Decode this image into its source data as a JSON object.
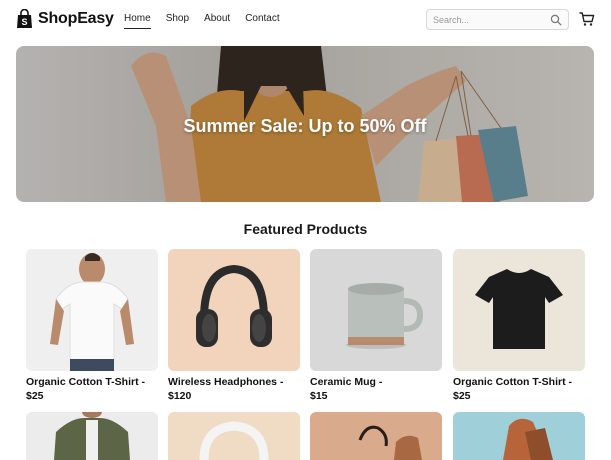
{
  "header": {
    "brand": "ShopEasy",
    "nav": [
      {
        "label": "Home",
        "active": true
      },
      {
        "label": "Shop",
        "active": false
      },
      {
        "label": "About",
        "active": false
      },
      {
        "label": "Contact",
        "active": false
      }
    ],
    "search_placeholder": "Search...",
    "icons": {
      "search": "search-icon",
      "cart": "cart-icon",
      "logo": "shopping-bag-icon"
    }
  },
  "hero": {
    "title": "Summer Sale: Up to 50% Off"
  },
  "featured": {
    "title": "Featured Products",
    "products": [
      {
        "name": "Organic Cotton T-Shirt -",
        "price": "$25"
      },
      {
        "name": "Wireless Headphones -",
        "price": "$120"
      },
      {
        "name": "Ceramic Mug -",
        "price": "$15"
      },
      {
        "name": "Organic Cotton T-Shirt -",
        "price": "$25"
      }
    ]
  },
  "colors": {
    "accent": "#222222",
    "card_bg_1": "#efefef",
    "card_bg_2": "#f2d4bd",
    "card_bg_3": "#d8d8d8",
    "card_bg_4": "#ebe5da"
  }
}
